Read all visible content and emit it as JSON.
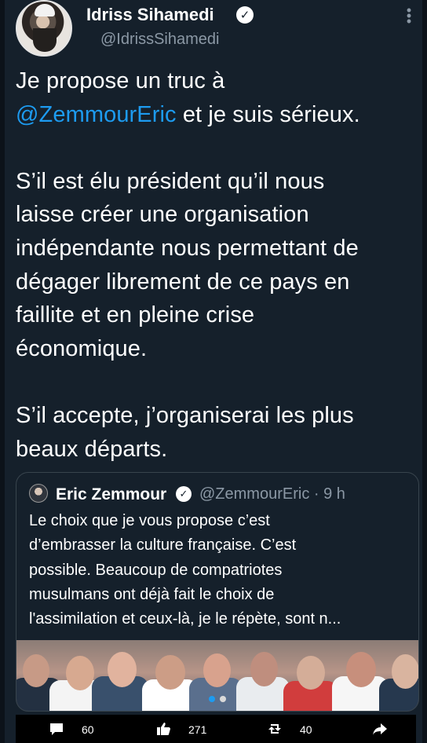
{
  "tweet": {
    "display_name": "Idriss Sihamedi",
    "handle": "@IdrissSihamedi",
    "text_lines": [
      {
        "text": "Je propose un truc à"
      },
      {
        "mention": "@ZemmourEric",
        "text": " et je suis sérieux."
      },
      {
        "text": ""
      },
      {
        "text": "S’il est élu président qu’il nous"
      },
      {
        "text": "laisse créer une organisation"
      },
      {
        "text": "indépendante nous permettant de"
      },
      {
        "text": "dégager librement de ce pays en"
      },
      {
        "text": "faillite et en pleine crise"
      },
      {
        "text": "économique."
      },
      {
        "text": ""
      },
      {
        "text": "S’il accepte, j’organiserai les plus"
      },
      {
        "text": "beaux départs."
      }
    ]
  },
  "quoted_tweet": {
    "display_name": "Eric Zemmour",
    "handle_time": "@ZemmourEric · 9 h",
    "text_lines": [
      "Le choix que je vous propose c’est",
      "d’embrasser la culture française. C’est",
      "possible. Beaucoup de compatriotes",
      "musulmans ont déjà fait le choix de",
      "l'assimilation et ceux-là, je le répète, sont n..."
    ]
  },
  "actions": {
    "comments": "60",
    "likes": "271",
    "retweets": "40"
  },
  "icons": {
    "more": "more-vertical-icon",
    "verified": "verified-badge-icon",
    "comment": "comment-icon",
    "like": "thumbs-up-icon",
    "retweet": "retweet-icon",
    "share": "share-arrow-icon"
  },
  "colors": {
    "background": "#15202b",
    "mention": "#1d9bf0",
    "muted": "#8b98a5",
    "border": "#38444d",
    "carousel_active": "#1d9bf0"
  }
}
